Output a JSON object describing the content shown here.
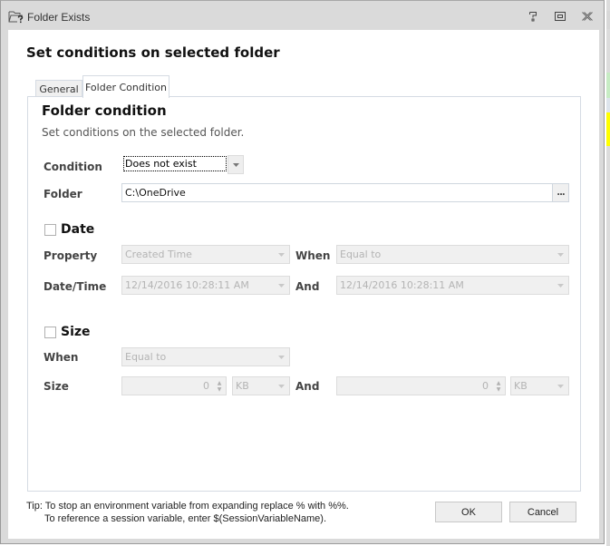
{
  "window": {
    "title": "Folder Exists",
    "icons": {
      "app": "folder-question-icon",
      "help": "help-icon",
      "maximize": "maximize-icon",
      "close": "close-icon"
    }
  },
  "heading": "Set conditions on selected folder",
  "tabs": [
    {
      "label": "General",
      "active": false
    },
    {
      "label": "Folder Condition",
      "active": true
    }
  ],
  "panel": {
    "title": "Folder condition",
    "subtitle": "Set conditions on the selected folder.",
    "condition": {
      "label": "Condition",
      "value": "Does not exist"
    },
    "folder": {
      "label": "Folder",
      "value": "C:\\OneDrive",
      "browse_label": "..."
    },
    "date": {
      "section_label": "Date",
      "checked": false,
      "property_label": "Property",
      "property_value": "Created Time",
      "when_label": "When",
      "when_value": "Equal to",
      "datetime_label": "Date/Time",
      "datetime_value": "12/14/2016 10:28:11 AM",
      "and_label": "And",
      "and_value": "12/14/2016 10:28:11 AM"
    },
    "size": {
      "section_label": "Size",
      "checked": false,
      "when_label": "When",
      "when_value": "Equal to",
      "size_label": "Size",
      "size_value": "0",
      "size_unit": "KB",
      "and_label": "And",
      "and_value": "0",
      "and_unit": "KB"
    }
  },
  "footer": {
    "tip_line1": "Tip: To stop an environment variable from expanding replace % with %%.",
    "tip_line2": "To reference a session variable, enter $(SessionVariableName).",
    "ok_label": "OK",
    "cancel_label": "Cancel"
  }
}
